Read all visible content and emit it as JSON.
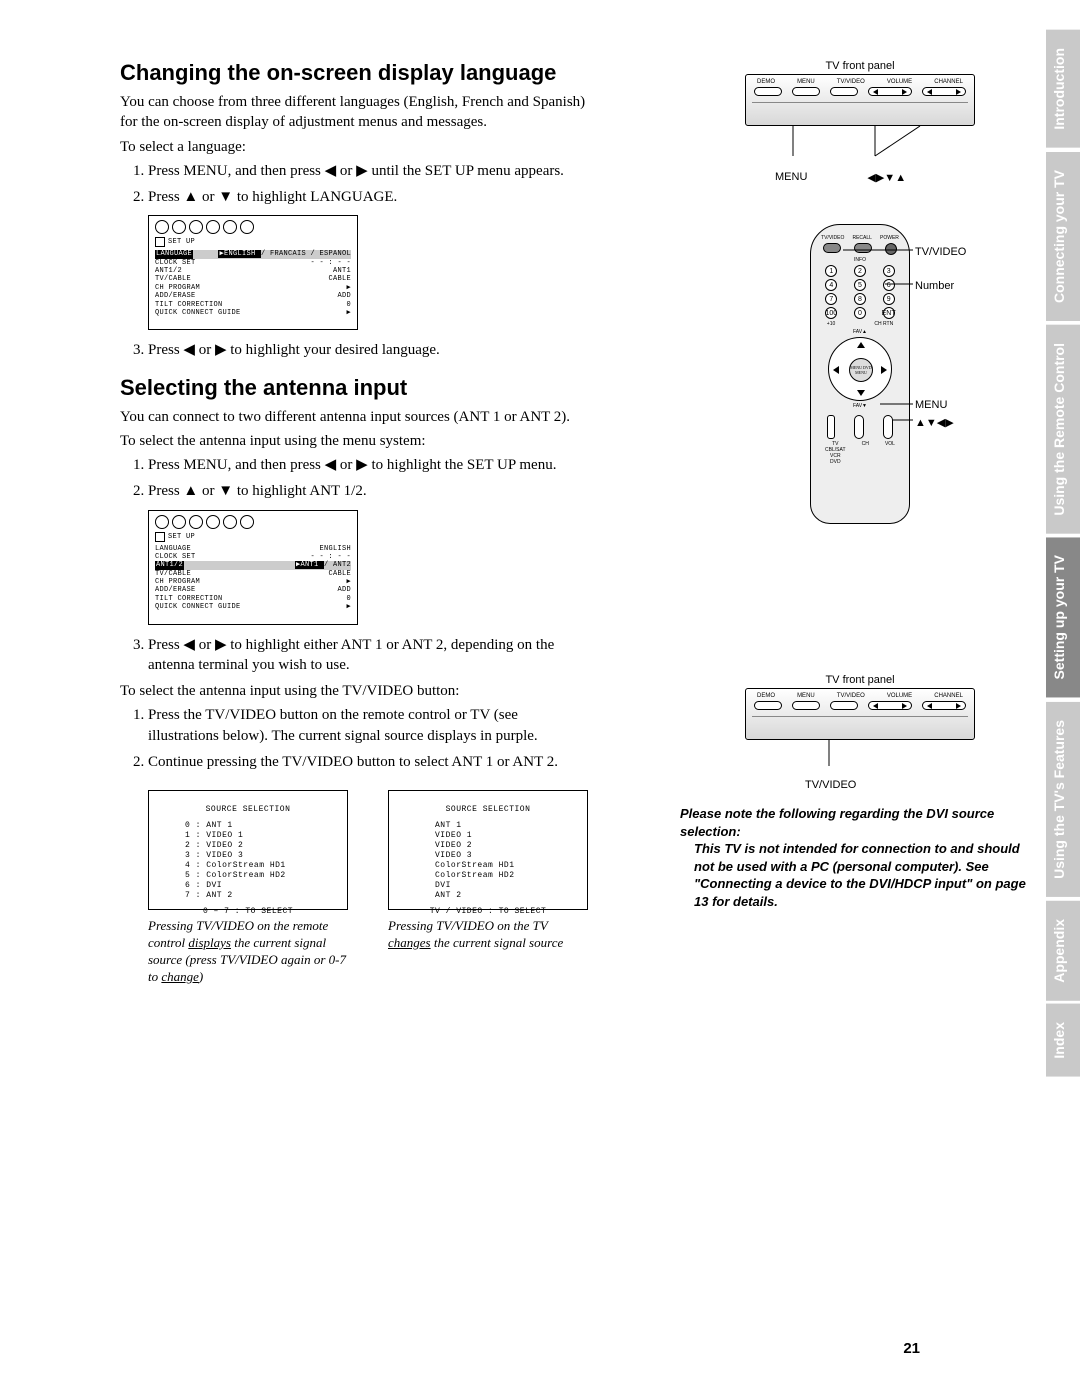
{
  "section1": {
    "heading": "Changing the on-screen display language",
    "intro": "You can choose from three different languages (English, French and Spanish) for the on-screen display of adjustment menus and messages.",
    "to_select": "To select a language:",
    "steps_a": [
      "Press MENU, and then press ◀ or ▶ until the SET UP menu appears.",
      "Press ▲ or ▼ to highlight LANGUAGE."
    ],
    "step3": "Press ◀ or ▶ to highlight your desired language."
  },
  "osd1": {
    "title": "SET UP",
    "rows": [
      {
        "l": "LANGUAGE",
        "r": "▶ENGLISH / FRANCAIS / ESPANOL",
        "hl": true
      },
      {
        "l": "CLOCK SET",
        "r": "- - : - -"
      },
      {
        "l": "ANT1/2",
        "r": "ANT1"
      },
      {
        "l": "TV/CABLE",
        "r": "CABLE"
      },
      {
        "l": "CH PROGRAM",
        "r": "▶"
      },
      {
        "l": "ADD/ERASE",
        "r": "ADD"
      },
      {
        "l": "TILT CORRECTION",
        "r": "0"
      },
      {
        "l": "QUICK CONNECT GUIDE",
        "r": "▶"
      }
    ]
  },
  "section2": {
    "heading": "Selecting the antenna input",
    "intro": "You can connect to two different antenna input sources (ANT 1 or ANT 2).",
    "to_select_menu": "To select the antenna input using the menu system:",
    "steps_a": [
      "Press MENU, and then press ◀ or ▶ to highlight the SET UP menu.",
      "Press ▲ or ▼ to highlight ANT 1/2."
    ],
    "step3": "Press ◀ or ▶ to highlight either ANT 1 or ANT 2, depending on the antenna terminal you wish to use.",
    "to_select_button": "To select the antenna input using the TV/VIDEO button:",
    "steps_b": [
      "Press the TV/VIDEO button on the remote control or TV (see illustrations below). The current signal source displays in purple.",
      "Continue pressing the TV/VIDEO button to select ANT 1 or ANT 2."
    ]
  },
  "osd2": {
    "title": "SET UP",
    "rows": [
      {
        "l": "LANGUAGE",
        "r": "ENGLISH"
      },
      {
        "l": "CLOCK SET",
        "r": "- - : - -"
      },
      {
        "l": "ANT1/2",
        "r": "▶ANT1 / ANT2",
        "hl": true
      },
      {
        "l": "TV/CABLE",
        "r": "CABLE"
      },
      {
        "l": "CH PROGRAM",
        "r": "▶"
      },
      {
        "l": "ADD/ERASE",
        "r": "ADD"
      },
      {
        "l": "TILT CORRECTION",
        "r": "0"
      },
      {
        "l": "QUICK CONNECT GUIDE",
        "r": "▶"
      }
    ]
  },
  "src1": {
    "title": "SOURCE SELECTION",
    "lines": [
      "0 : ANT 1",
      "1 : VIDEO 1",
      "2 : VIDEO 2",
      "3 : VIDEO 3",
      "4 : ColorStream HD1",
      "5 : ColorStream HD2",
      "6 : DVI",
      "7 : ANT 2"
    ],
    "foot": "0 – 7 : TO SELECT"
  },
  "src2": {
    "title": "SOURCE SELECTION",
    "lines": [
      "ANT 1",
      "VIDEO 1",
      "VIDEO 2",
      "VIDEO 3",
      "ColorStream HD1",
      "ColorStream HD2",
      "DVI",
      "ANT 2"
    ],
    "foot": "TV / VIDEO : TO SELECT"
  },
  "caption1_pre": "Pressing TV/VIDEO on the remote control ",
  "caption1_u": "displays",
  "caption1_post": " the current signal source (press TV/VIDEO again or 0-7 to ",
  "caption1_u2": "change",
  "caption1_end": ")",
  "caption2_pre": "Pressing TV/VIDEO on the TV ",
  "caption2_u": "changes",
  "caption2_post": " the current signal source",
  "tv_panel": {
    "label": "TV front panel",
    "btns": [
      "DEMO",
      "MENU",
      "TV/VIDEO",
      "VOLUME",
      "CHANNEL"
    ]
  },
  "pointer_menu": "MENU",
  "pointer_arrows": "◀▶▼▲",
  "pointer_tvvideo": "TV/VIDEO",
  "remote": {
    "top_labels": [
      "TV/VIDEO",
      "RECALL",
      "POWER"
    ],
    "info": "INFO",
    "nums": [
      [
        "1",
        "2",
        "3"
      ],
      [
        "4",
        "5",
        "6"
      ],
      [
        "7",
        "8",
        "9"
      ],
      [
        "100",
        "0",
        "ENT"
      ]
    ],
    "below_nums": [
      "+10",
      "",
      "CH RTN"
    ],
    "fav": "FAV▲",
    "favd": "FAV▼",
    "menu_center": "MENU\nDVD MENU",
    "bottom_cols": [
      "TV\nCBL/SAT\nVCR\nDVD",
      "CH",
      "VOL"
    ],
    "side_tvvideo": "TV/VIDEO",
    "side_number": "Number",
    "side_menu": "MENU",
    "side_arrows": "▲▼◀▶"
  },
  "dvi": {
    "lead": "Please note the following regarding the DVI source selection:",
    "body": "This TV is not intended for connection to and should not be used with a PC (personal computer). See \"Connecting a device to the DVI/HDCP input\" on page 13 for details."
  },
  "tabs": [
    "Introduction",
    "Connecting your TV",
    "Using the Remote Control",
    "Setting up your TV",
    "Using the TV's Features",
    "Appendix",
    "Index"
  ],
  "active_tab_index": 3,
  "page_number": "21"
}
